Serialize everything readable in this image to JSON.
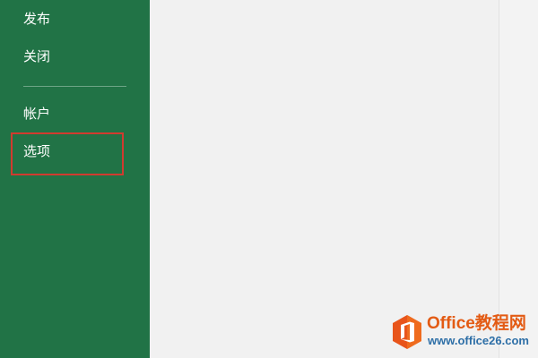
{
  "sidebar": {
    "bg_color": "#217346",
    "items": [
      {
        "label": "发布"
      },
      {
        "label": "关闭"
      },
      {
        "label": "帐户"
      },
      {
        "label": "选项"
      }
    ],
    "highlight_color": "#d13b2f"
  },
  "watermark": {
    "title": "Office教程网",
    "url": "www.office26.com",
    "icon": "office-logo-icon"
  }
}
